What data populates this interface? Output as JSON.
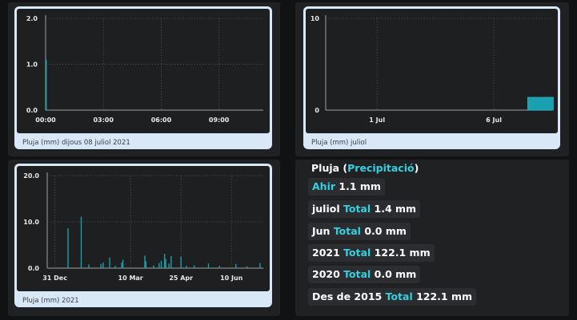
{
  "cards": [
    {
      "caption": "Pluja (mm) dijous 08 juliol 2021",
      "chart_data": {
        "type": "bar",
        "x_ticks": [
          "00:00",
          "03:00",
          "06:00",
          "09:00"
        ],
        "y_ticks": [
          "0.0",
          "1.0",
          "2.0"
        ],
        "ylim": [
          0,
          2
        ],
        "x_range_hours": [
          0,
          11.3
        ],
        "bars": [
          {
            "x": 0.0,
            "value": 1.1
          }
        ],
        "grid": true,
        "accent": "#1aa0ae"
      }
    },
    {
      "caption": "Pluja (mm) juliol",
      "chart_data": {
        "type": "bar",
        "x_ticks": [
          "1 Jul",
          "6 Jul"
        ],
        "y_ticks": [
          "0",
          "10"
        ],
        "ylim": [
          0,
          10
        ],
        "x_range_days": [
          -1.2,
          8.5
        ],
        "bars": [
          {
            "day": 8,
            "value": 1.4
          }
        ],
        "grid": true,
        "accent": "#1aa0ae"
      }
    },
    {
      "caption": "Pluja (mm) 2021",
      "chart_data": {
        "type": "bar",
        "x_ticks": [
          "31 Dec",
          "10 Mar",
          "25 Apr",
          "10 Jun"
        ],
        "y_ticks": [
          "0.0",
          "10.0",
          "20.0"
        ],
        "ylim": [
          0,
          20
        ],
        "x_range_days": [
          -7,
          190
        ],
        "bars": [
          {
            "day": 12,
            "value": 8.6
          },
          {
            "day": 24,
            "value": 11.1
          },
          {
            "day": 31,
            "value": 0.8
          },
          {
            "day": 42,
            "value": 0.9
          },
          {
            "day": 44,
            "value": 1.2
          },
          {
            "day": 50,
            "value": 2.3
          },
          {
            "day": 55,
            "value": 0.5
          },
          {
            "day": 61,
            "value": 1.2
          },
          {
            "day": 62,
            "value": 1.8
          },
          {
            "day": 82,
            "value": 2.7
          },
          {
            "day": 83,
            "value": 1.5
          },
          {
            "day": 90,
            "value": 0.6
          },
          {
            "day": 95,
            "value": 1.1
          },
          {
            "day": 97,
            "value": 1.6
          },
          {
            "day": 100,
            "value": 3.1
          },
          {
            "day": 101,
            "value": 2.0
          },
          {
            "day": 104,
            "value": 1.0
          },
          {
            "day": 106,
            "value": 2.6
          },
          {
            "day": 115,
            "value": 2.5
          },
          {
            "day": 120,
            "value": 0.5
          },
          {
            "day": 127,
            "value": 0.6
          },
          {
            "day": 140,
            "value": 1.0
          },
          {
            "day": 150,
            "value": 0.5
          },
          {
            "day": 165,
            "value": 0.9
          },
          {
            "day": 175,
            "value": 0.4
          },
          {
            "day": 187,
            "value": 1.1
          }
        ],
        "grid": true,
        "accent": "#1aa0ae"
      }
    }
  ],
  "stats": {
    "title_prefix": "Pluja (",
    "title_accent": "Precipitació",
    "title_suffix": ")",
    "rows": [
      {
        "label": "Ahir",
        "accent": "",
        "value": "1.1 mm",
        "label_is_accent": true
      },
      {
        "label": "juliol",
        "accent": "Total",
        "value": "1.4 mm",
        "label_is_accent": false
      },
      {
        "label": "Jun",
        "accent": "Total",
        "value": "0.0 mm",
        "label_is_accent": false
      },
      {
        "label": "2021",
        "accent": "Total",
        "value": "122.1 mm",
        "label_is_accent": false
      },
      {
        "label": "2020",
        "accent": "Total",
        "value": "0.0 mm",
        "label_is_accent": false
      },
      {
        "label": "Des de 2015",
        "accent": "Total",
        "value": "122.1 mm",
        "label_is_accent": false
      }
    ]
  }
}
